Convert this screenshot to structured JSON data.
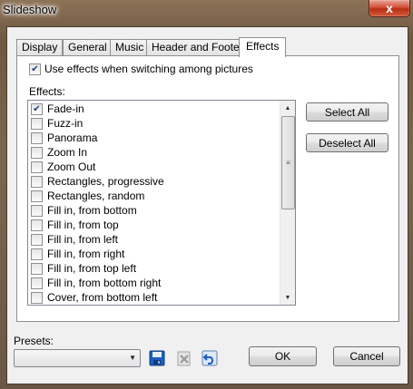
{
  "window": {
    "title": "Slideshow",
    "close_glyph": "x"
  },
  "tabs": [
    {
      "label": "Display",
      "active": false
    },
    {
      "label": "General",
      "active": false
    },
    {
      "label": "Music",
      "active": false
    },
    {
      "label": "Header and Footer",
      "active": false
    },
    {
      "label": "Effects",
      "active": true
    }
  ],
  "use_effects": {
    "label": "Use effects when switching among pictures",
    "checked": true
  },
  "effects_label": "Effects:",
  "effects": [
    {
      "label": "Fade-in",
      "checked": true
    },
    {
      "label": "Fuzz-in",
      "checked": false
    },
    {
      "label": "Panorama",
      "checked": false
    },
    {
      "label": "Zoom In",
      "checked": false
    },
    {
      "label": "Zoom Out",
      "checked": false
    },
    {
      "label": "Rectangles, progressive",
      "checked": false
    },
    {
      "label": "Rectangles, random",
      "checked": false
    },
    {
      "label": "Fill in, from bottom",
      "checked": false
    },
    {
      "label": "Fill in, from top",
      "checked": false
    },
    {
      "label": "Fill in, from left",
      "checked": false
    },
    {
      "label": "Fill in, from right",
      "checked": false
    },
    {
      "label": "Fill in, from top left",
      "checked": false
    },
    {
      "label": "Fill in, from bottom right",
      "checked": false
    },
    {
      "label": "Cover, from bottom left",
      "checked": false
    }
  ],
  "buttons": {
    "select_all": "Select All",
    "deselect_all": "Deselect All",
    "ok": "OK",
    "cancel": "Cancel"
  },
  "presets": {
    "label": "Presets:",
    "value": ""
  },
  "icons": [
    "save-icon",
    "delete-icon",
    "undo-icon"
  ],
  "colors": {
    "accent": "#1d5fbf",
    "close": "#c7432a"
  }
}
